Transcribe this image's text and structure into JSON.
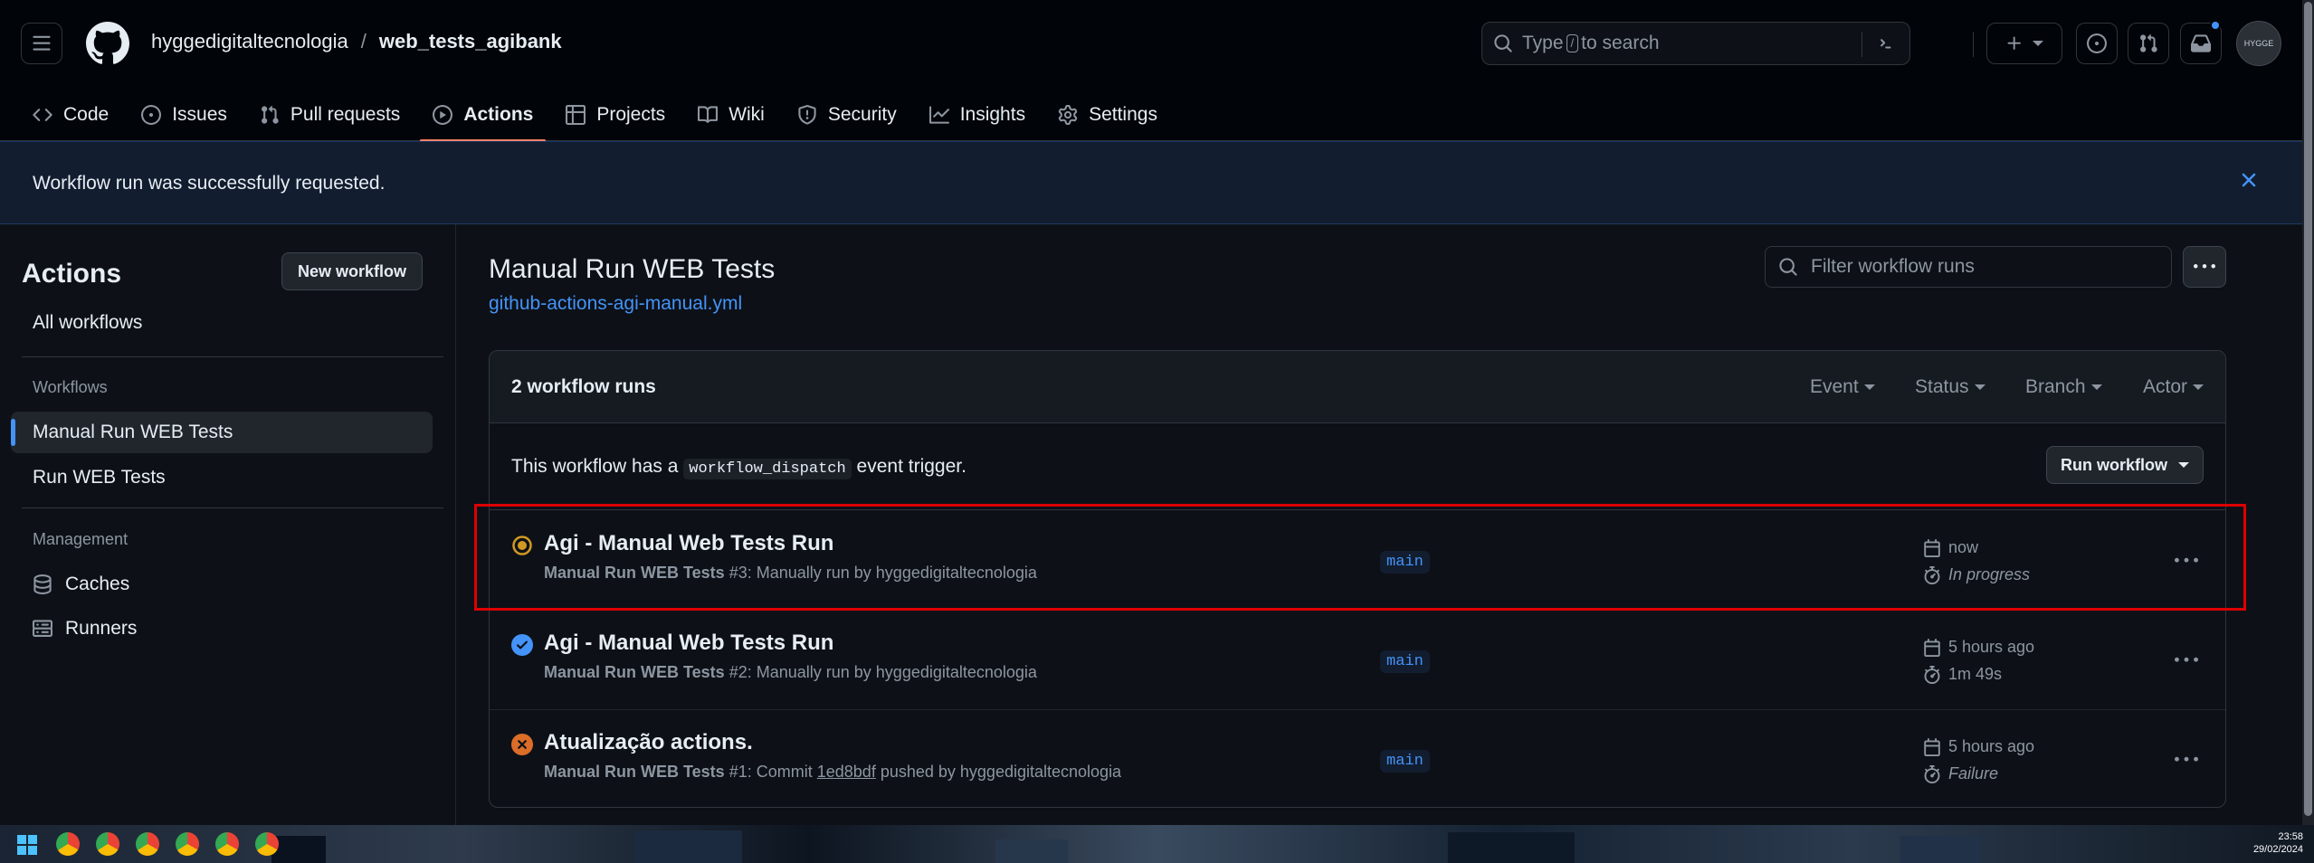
{
  "header": {
    "owner": "hyggedigitaltecnologia",
    "separator": "/",
    "repo": "web_tests_agibank",
    "search_prefix": "Type",
    "search_key": "/",
    "search_suffix": "to search",
    "avatar_text": "HYGGE"
  },
  "nav": {
    "tabs": [
      {
        "label": "Code",
        "icon": "code-icon"
      },
      {
        "label": "Issues",
        "icon": "issue-icon"
      },
      {
        "label": "Pull requests",
        "icon": "pull-request-icon"
      },
      {
        "label": "Actions",
        "icon": "play-icon",
        "active": true
      },
      {
        "label": "Projects",
        "icon": "table-icon"
      },
      {
        "label": "Wiki",
        "icon": "book-icon"
      },
      {
        "label": "Security",
        "icon": "shield-icon"
      },
      {
        "label": "Insights",
        "icon": "graph-icon"
      },
      {
        "label": "Settings",
        "icon": "gear-icon"
      }
    ]
  },
  "flash": {
    "message": "Workflow run was successfully requested."
  },
  "sidebar": {
    "title": "Actions",
    "new_workflow": "New workflow",
    "all_workflows": "All workflows",
    "workflows_heading": "Workflows",
    "workflows": [
      "Manual Run WEB Tests",
      "Run WEB Tests"
    ],
    "management_heading": "Management",
    "management": [
      {
        "label": "Caches",
        "icon": "database-icon"
      },
      {
        "label": "Runners",
        "icon": "server-icon"
      }
    ]
  },
  "main": {
    "title": "Manual Run WEB Tests",
    "file": "github-actions-agi-manual.yml",
    "filter_placeholder": "Filter workflow runs",
    "runs_count": "2 workflow runs",
    "filters": [
      "Event",
      "Status",
      "Branch",
      "Actor"
    ],
    "dispatch_prefix": "This workflow has a",
    "dispatch_code": "workflow_dispatch",
    "dispatch_suffix": "event trigger.",
    "run_workflow": "Run workflow",
    "runs": [
      {
        "title": "Agi - Manual Web Tests Run",
        "workflow": "Manual Run WEB Tests",
        "detail": "#3: Manually run by hyggedigitaltecnologia",
        "branch": "main",
        "when": "now",
        "duration": "In progress",
        "status": "in-progress"
      },
      {
        "title": "Agi - Manual Web Tests Run",
        "workflow": "Manual Run WEB Tests",
        "detail": "#2: Manually run by hyggedigitaltecnologia",
        "branch": "main",
        "when": "5 hours ago",
        "duration": "1m 49s",
        "status": "success"
      },
      {
        "title": "Atualização actions.",
        "workflow": "Manual Run WEB Tests",
        "detail_prefix": "#1: Commit",
        "sha": "1ed8bdf",
        "detail_suffix": "pushed by hyggedigitaltecnologia",
        "branch": "main",
        "when": "5 hours ago",
        "duration": "Failure",
        "status": "failure"
      }
    ]
  },
  "taskbar": {
    "time": "23:58",
    "date": "29/02/2024"
  },
  "colors": {
    "accent": "#4493f8",
    "active_tab": "#f78166",
    "in_progress": "#d29922",
    "success": "#4493f8",
    "failure": "#db6d28",
    "highlight": "#dd0000"
  }
}
